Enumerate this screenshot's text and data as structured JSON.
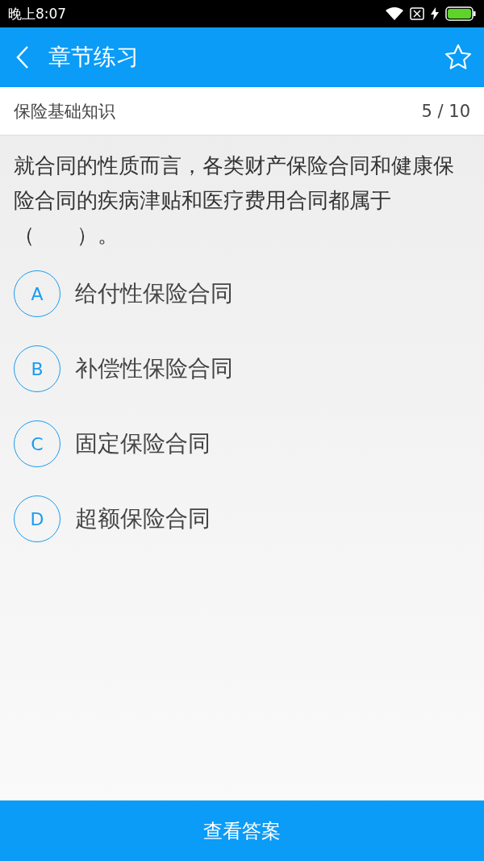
{
  "status_bar": {
    "time": "晚上8:07"
  },
  "header": {
    "title": "章节练习",
    "favorited": false
  },
  "subheader": {
    "chapter": "保险基础知识",
    "progress": "5 / 10"
  },
  "question": "就合同的性质而言，各类财产保险合同和健康保险合同的疾病津贴和医疗费用合同都属于（　　）。",
  "options": [
    {
      "letter": "A",
      "text": "给付性保险合同",
      "selected": false
    },
    {
      "letter": "B",
      "text": "补偿性保险合同",
      "selected": false
    },
    {
      "letter": "C",
      "text": "固定保险合同",
      "selected": false
    },
    {
      "letter": "D",
      "text": "超额保险合同",
      "selected": false
    }
  ],
  "footer_button": "查看答案"
}
